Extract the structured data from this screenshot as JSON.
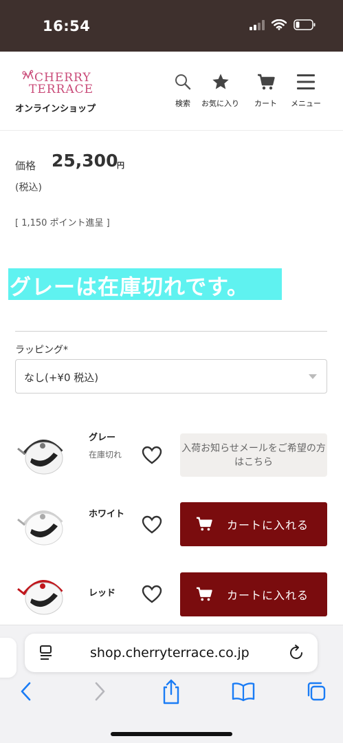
{
  "status_bar": {
    "time": "16:54"
  },
  "header": {
    "logo": {
      "line1": "CHERRY",
      "line2": "TERRACE"
    },
    "shop_label": "オンラインショップ",
    "nav": [
      {
        "label": "検索",
        "icon": "search-icon"
      },
      {
        "label": "お気に入り",
        "icon": "star-icon"
      },
      {
        "label": "カート",
        "icon": "cart-icon"
      },
      {
        "label": "メニュー",
        "icon": "menu-icon"
      }
    ]
  },
  "price": {
    "label": "価格",
    "value": "25,300",
    "unit": "円",
    "tax_note": "(税込)",
    "points": "[ 1,150 ポイント進呈 ]"
  },
  "banner": {
    "text": "グレーは在庫切れです。",
    "color": "#5ff2f0"
  },
  "wrapping": {
    "label": "ラッピング*",
    "selected": "なし(+¥0 税込)"
  },
  "variants": [
    {
      "color": "グレー",
      "stock_note": "在庫切れ",
      "action": "入荷お知らせメールをご希望の方はこちら",
      "accent": "#333333"
    },
    {
      "color": "ホワイト",
      "stock_note": "",
      "action": "カートに入れる",
      "accent": "#dddddd"
    },
    {
      "color": "レッド",
      "stock_note": "",
      "action": "カートに入れる",
      "accent": "#c0161c"
    }
  ],
  "browser": {
    "url": "shop.cherryterrace.co.jp",
    "toolbar": [
      "back-icon",
      "forward-icon",
      "share-icon",
      "bookmarks-icon",
      "tabs-icon"
    ]
  },
  "colors": {
    "cart_button": "#7a0c0e",
    "status_bar": "#3e302d",
    "logo": "#c94a78",
    "ios_blue": "#1a7cf5"
  }
}
